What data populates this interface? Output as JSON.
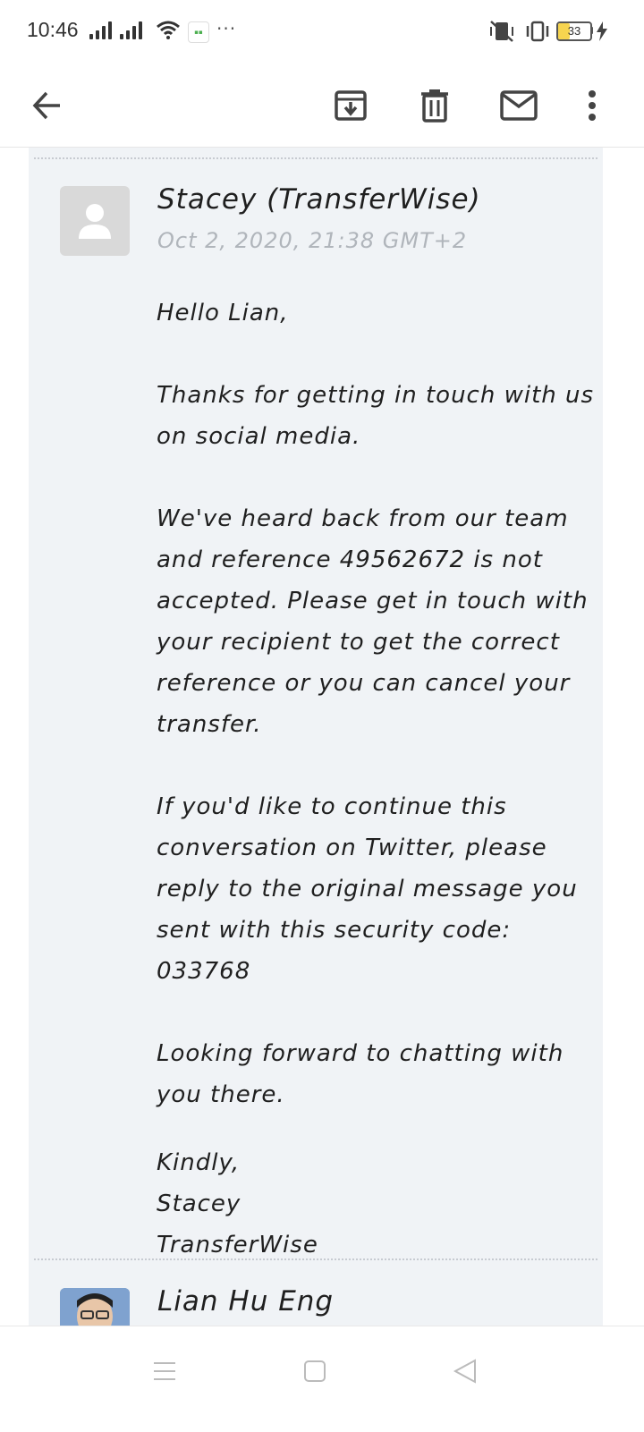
{
  "status_bar": {
    "time": "10:46",
    "battery_level": "33",
    "more": "···"
  },
  "toolbar": {
    "back_icon": "arrow-back-icon",
    "archive_icon": "archive-icon",
    "delete_icon": "delete-icon",
    "mark_unread_icon": "mail-icon",
    "more_icon": "more-vert-icon"
  },
  "message": {
    "sender": "Stacey (TransferWise)",
    "date": "Oct 2, 2020, 21:38 GMT+2",
    "greeting": "Hello Lian,",
    "para1": "Thanks for getting in touch with us on social media.",
    "para2": "We've heard back from our team and reference 49562672 is not accepted. Please get in touch with your recipient to get the correct reference or you can cancel your transfer.",
    "para3": "If you'd like to continue this conversation on Twitter, please reply to the original message you sent with this security code: 033768",
    "para4": "Looking forward to chatting with you there.",
    "signoff1": "Kindly,",
    "signoff2": "Stacey",
    "signoff3": "TransferWise"
  },
  "next_message": {
    "sender": "Lian Hu Eng"
  },
  "colors": {
    "card_bg": "#f0f3f6",
    "date_text": "#b0b5bb"
  }
}
